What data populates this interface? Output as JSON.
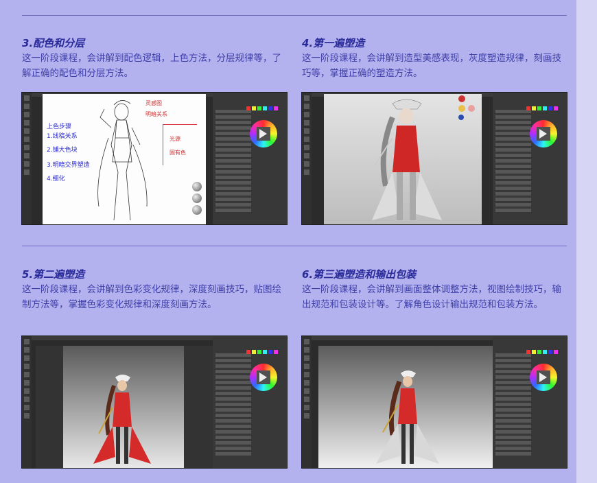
{
  "sections": [
    {
      "title": "3.配色和分层",
      "desc": "这一阶段课程，会讲解到配色逻辑，上色方法，分层规律等，了解正确的配色和分层方法。"
    },
    {
      "title": "4.第一遍塑造",
      "desc": "这一阶段课程，会讲解到造型美感表现，灰度塑造规律，刻画技巧等，掌握正确的塑造方法。"
    },
    {
      "title": "5.第二遍塑造",
      "desc": "这一阶段课程，会讲解到色彩变化规律，深度刻画技巧，贴图绘制方法等，掌握色彩变化规律和深度刻画方法。"
    },
    {
      "title": "6.第三遍塑造和输出包装",
      "desc": "这一阶段课程，会讲解到画面整体调整方法，视图绘制技巧，输出规范和包装设计等。了解角色设计输出规范和包装方法。"
    }
  ],
  "sketch_notes": {
    "n1": "上色步骤",
    "n2": "1.线稿关系",
    "n3": "2.铺大色块",
    "n4": "3.明暗交界塑造",
    "n5": "4.细化",
    "r1": "灵感图",
    "r2": "明暗关系",
    "r3": "光源",
    "r4": "固有色"
  },
  "colors": {
    "background": "#b4b2ee",
    "title": "#2a2b9a",
    "text": "#3e3fa8",
    "accent_red": "#d42a2a"
  }
}
